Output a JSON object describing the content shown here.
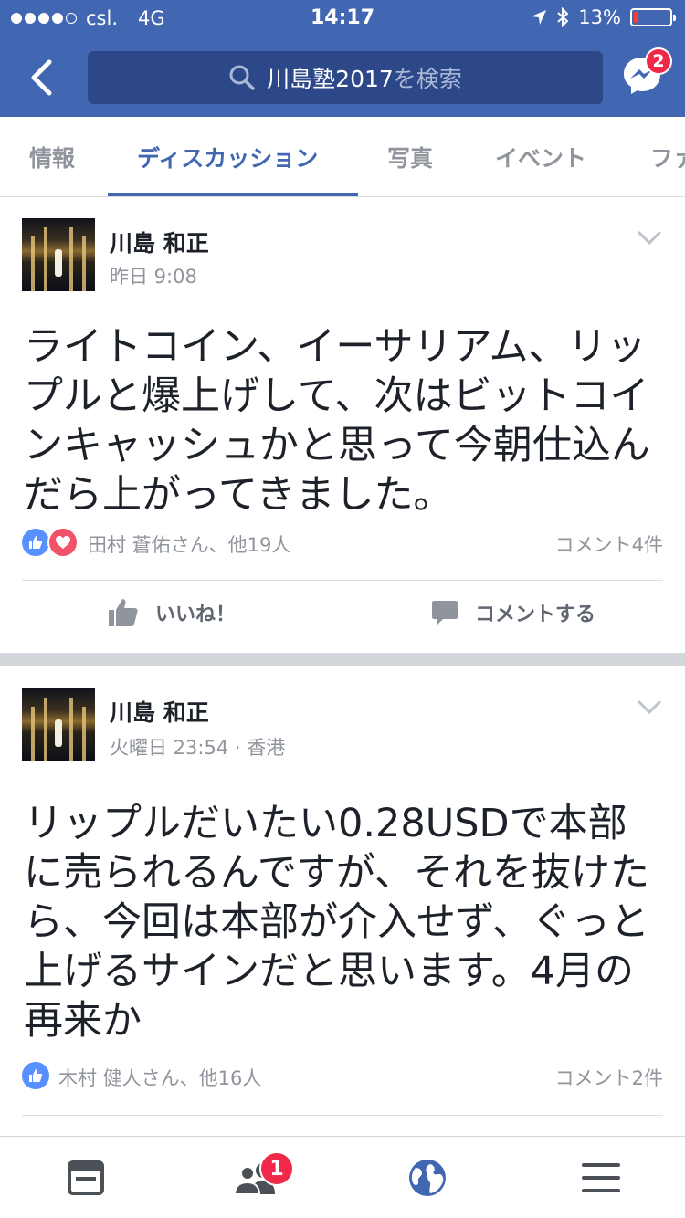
{
  "status_bar": {
    "carrier": "csl.",
    "network": "4G",
    "time": "14:17",
    "battery_percent": "13%",
    "battery_level": 0.13
  },
  "header": {
    "search_query": "川島塾2017",
    "search_suffix": "を検索",
    "messenger_badge": "2"
  },
  "tabs": [
    {
      "label": "情報",
      "active": false
    },
    {
      "label": "ディスカッション",
      "active": true
    },
    {
      "label": "写真",
      "active": false
    },
    {
      "label": "イベント",
      "active": false
    },
    {
      "label": "ファ",
      "active": false
    }
  ],
  "posts": [
    {
      "author": "川島 和正",
      "time": "昨日 9:08",
      "text": "ライトコイン、イーサリアム、リップルと爆上げして、次はビットコインキャッシュかと思って今朝仕込んだら上がってきました。",
      "reactions": [
        "like",
        "love"
      ],
      "reactor_summary": "田村 蒼佑さん、他19人",
      "comment_count": "コメント4件",
      "like_label": "いいね！",
      "comment_label": "コメントする"
    },
    {
      "author": "川島 和正",
      "time": "火曜日 23:54 · 香港",
      "text": "リップルだいたい0.28USDで本部に売られるんですが、それを抜けたら、今回は本部が介入せず、ぐっと上げるサインだと思います。4月の再来か",
      "reactions": [
        "like"
      ],
      "reactor_summary": "木村 健人さん、他16人",
      "comment_count": "コメント2件"
    }
  ],
  "bottom_nav": {
    "items": [
      "news-feed",
      "friends",
      "notifications",
      "menu"
    ],
    "friends_badge": "1"
  },
  "colors": {
    "brand": "#4267b2",
    "search_bg": "#2d4888",
    "like_blue": "#5890ff",
    "love_red": "#f25268",
    "badge_red": "#f02849",
    "muted_text": "#90949c"
  }
}
